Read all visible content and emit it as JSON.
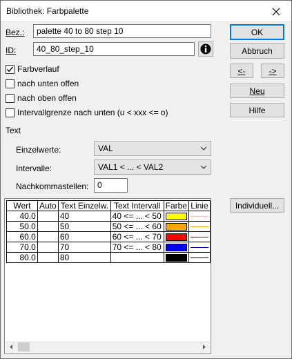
{
  "window": {
    "title": "Bibliothek: Farbpalette"
  },
  "fields": {
    "bez_label": "Bez.:",
    "bez_value": "palette 40 to 80 step 10",
    "id_label": "ID:",
    "id_value": "40_80_step_10"
  },
  "buttons": {
    "ok": "OK",
    "abbruch": "Abbruch",
    "prev": "<-",
    "next": "->",
    "neu": "Neu",
    "hilfe": "Hilfe",
    "individuell": "Individuell..."
  },
  "checkboxes": [
    {
      "label": "Farbverlauf",
      "checked": true
    },
    {
      "label": "nach unten offen",
      "checked": false
    },
    {
      "label": "nach oben offen",
      "checked": false
    },
    {
      "label": "Intervallgrenze nach unten (u < xxx <= o)",
      "checked": false
    }
  ],
  "text_section": {
    "heading": "Text",
    "einzelwerte_label": "Einzelwerte:",
    "einzelwerte_value": "VAL",
    "intervalle_label": "Intervalle:",
    "intervalle_value": "VAL1 < ... < VAL2",
    "nachkomma_label": "Nachkommastellen:",
    "nachkomma_value": "0"
  },
  "table": {
    "headers": [
      "Wert",
      "Auto",
      "Text Einzelw.",
      "Text Intervall",
      "Farbe",
      "Linie"
    ],
    "rows": [
      {
        "wert": "40.0",
        "auto": "",
        "text": "40",
        "intervall": "40 <= ... < 50",
        "farbe": "#ffff00",
        "linie": "#ffd800"
      },
      {
        "wert": "50.0",
        "auto": "",
        "text": "50",
        "intervall": "50 <= ... < 60",
        "farbe": "#ffa500",
        "linie": "#ff9500"
      },
      {
        "wert": "60.0",
        "auto": "",
        "text": "60",
        "intervall": "60 <= ... < 70",
        "farbe": "#ff0000",
        "linie": "#a00000"
      },
      {
        "wert": "70.0",
        "auto": "",
        "text": "70",
        "intervall": "70 <= ... < 80",
        "farbe": "#0000ff",
        "linie": "#0000a0"
      },
      {
        "wert": "80.0",
        "auto": "",
        "text": "80",
        "intervall": "",
        "farbe": "#000000",
        "linie": "#000000"
      }
    ]
  },
  "icons": {
    "close": "close-icon",
    "info": "info-icon",
    "dropdown": "chevron-down-icon",
    "scroll_left": "arrow-left-icon",
    "scroll_right": "arrow-right-icon"
  }
}
